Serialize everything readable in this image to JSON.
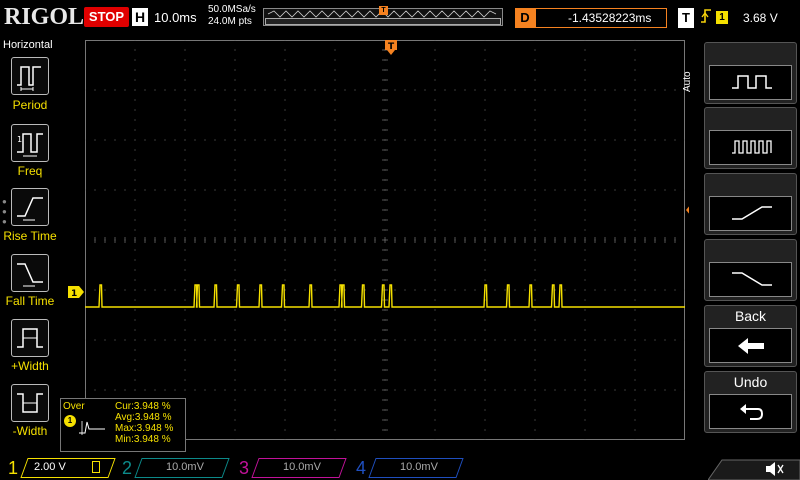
{
  "brand": "RIGOL",
  "status": {
    "run_state": "STOP",
    "color": "#e00000"
  },
  "horizontal": {
    "label": "H",
    "timebase": "10.0ms",
    "sample_rate": "50.0MSa/s",
    "memory_depth": "24.0M pts",
    "trigger_marker": "T"
  },
  "delay": {
    "label": "D",
    "value": "-1.43528223ms",
    "color": "#f58220"
  },
  "trigger": {
    "label": "T",
    "edge_icon": "rising-edge-icon",
    "source": "1",
    "level": "3.68 V"
  },
  "left_menu": {
    "title": "Horizontal",
    "items": [
      {
        "label": "Period",
        "icon": "period-icon"
      },
      {
        "label": "Freq",
        "icon": "frequency-icon"
      },
      {
        "label": "Rise Time",
        "icon": "rise-time-icon"
      },
      {
        "label": "Fall Time",
        "icon": "fall-time-icon"
      },
      {
        "label": "+Width",
        "icon": "positive-width-icon"
      },
      {
        "label": "-Width",
        "icon": "negative-width-icon"
      }
    ]
  },
  "right_menu": {
    "mode_label": "Auto",
    "items": [
      {
        "label": "",
        "icon": "square-wave-icon"
      },
      {
        "label": "",
        "icon": "pulse-train-icon"
      },
      {
        "label": "",
        "icon": "rising-slope-icon"
      },
      {
        "label": "",
        "icon": "falling-slope-icon"
      },
      {
        "label": "Back",
        "icon": "back-arrow-icon"
      },
      {
        "label": "Undo",
        "icon": "undo-icon"
      }
    ]
  },
  "waveform": {
    "channel_marker": "1",
    "trigger_marker": "T",
    "color": "#f5e000",
    "high_level_div": 3.3,
    "low_level_div": 1.0,
    "pulse_times_div": [
      0.3,
      2.2,
      2.25,
      2.6,
      3.05,
      3.5,
      3.95,
      4.5,
      5.1,
      5.15,
      5.55,
      5.95,
      6.1,
      8.0,
      8.45,
      8.9,
      9.35,
      9.5
    ]
  },
  "measurement": {
    "title": "Over",
    "channel": "1",
    "cur": "Cur:3.948 %",
    "avg": "Avg:3.948 %",
    "max": "Max:3.948 %",
    "min": "Min:3.948 %"
  },
  "channels": [
    {
      "num": "1",
      "scale": "2.00 V",
      "color": "#f5e000"
    },
    {
      "num": "2",
      "scale": "10.0mV",
      "color": "#0c8a8a"
    },
    {
      "num": "3",
      "scale": "10.0mV",
      "color": "#c2129a"
    },
    {
      "num": "4",
      "scale": "10.0mV",
      "color": "#1f4fbf"
    }
  ],
  "audio_icon": "speaker-icon"
}
